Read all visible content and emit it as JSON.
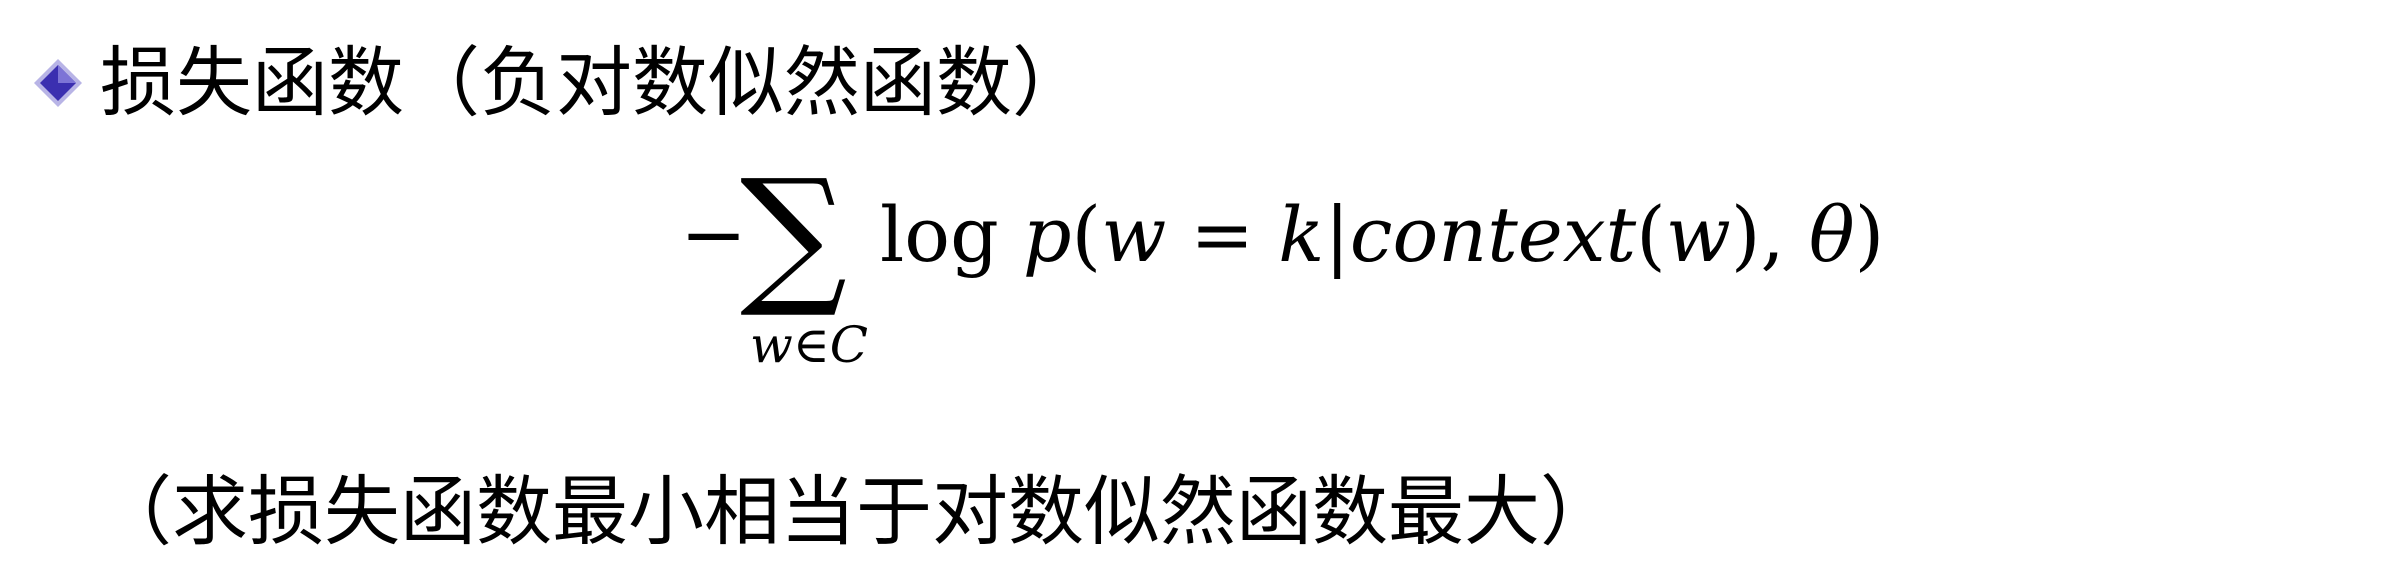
{
  "bullet": {
    "icon": "diamond-bullet-icon",
    "color": "#3b2fb0",
    "text": "损失函数（负对数似然函数）"
  },
  "formula": {
    "minus": "−",
    "sigma": "∑",
    "subscript": "w∈C",
    "log": "log ",
    "p": "p",
    "open_paren": "(",
    "w1": "w",
    "equals": " = ",
    "k": "k",
    "bar": "|",
    "context": "context",
    "paren_w_open": "(",
    "w2": "w",
    "paren_w_close": ")",
    "comma": ", ",
    "theta": "θ",
    "close_paren": ")"
  },
  "note": {
    "text": "（求损失函数最小相当于对数似然函数最大）"
  }
}
